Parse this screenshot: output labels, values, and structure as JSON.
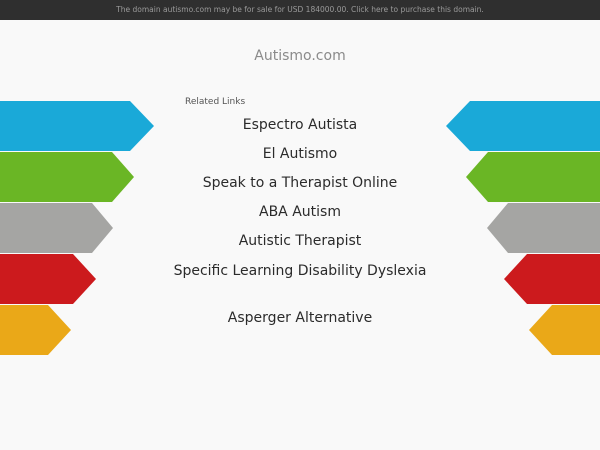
{
  "topbar": {
    "text": "The domain autismo.com may be for sale for USD 184000.00. Click here to purchase this domain."
  },
  "domain_title": "Autismo.com",
  "related_links": {
    "heading": "Related Links",
    "links": [
      {
        "label": "Espectro Autista"
      },
      {
        "label": "El Autismo"
      },
      {
        "label": "Speak to a Therapist Online"
      },
      {
        "label": "ABA Autism"
      },
      {
        "label": "Autistic Therapist"
      },
      {
        "label": "Specific Learning Disability Dyslexia"
      },
      {
        "label": "Asperger Alternative"
      }
    ]
  },
  "colors": {
    "background": "#f9f9f9",
    "topbar": "#2f2f2f",
    "arrow_blue": "#1aa9d8",
    "arrow_green": "#6ab625",
    "arrow_gray": "#a5a5a3",
    "arrow_red": "#cc1a1d",
    "arrow_orange": "#eaa818"
  }
}
